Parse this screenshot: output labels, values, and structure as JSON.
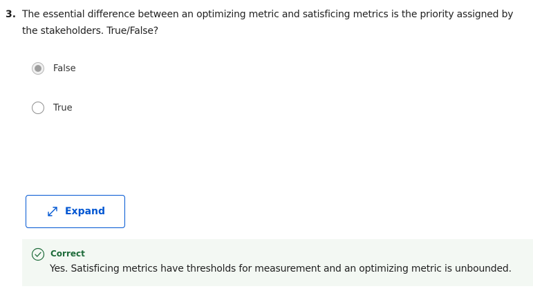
{
  "question": {
    "number": "3.",
    "text": "The essential difference between an optimizing metric and satisficing metrics is the priority assigned by the stakeholders. True/False?"
  },
  "options": [
    {
      "label": "False",
      "selected": true
    },
    {
      "label": "True",
      "selected": false
    }
  ],
  "expand_button": {
    "label": "Expand",
    "icon": "expand-arrows-icon",
    "color": "#0056d2"
  },
  "feedback": {
    "status": "Correct",
    "status_icon": "check-circle-icon",
    "status_color": "#1e6b3a",
    "message": "Yes. Satisficing metrics have thresholds for measurement and an optimizing metric is unbounded."
  }
}
